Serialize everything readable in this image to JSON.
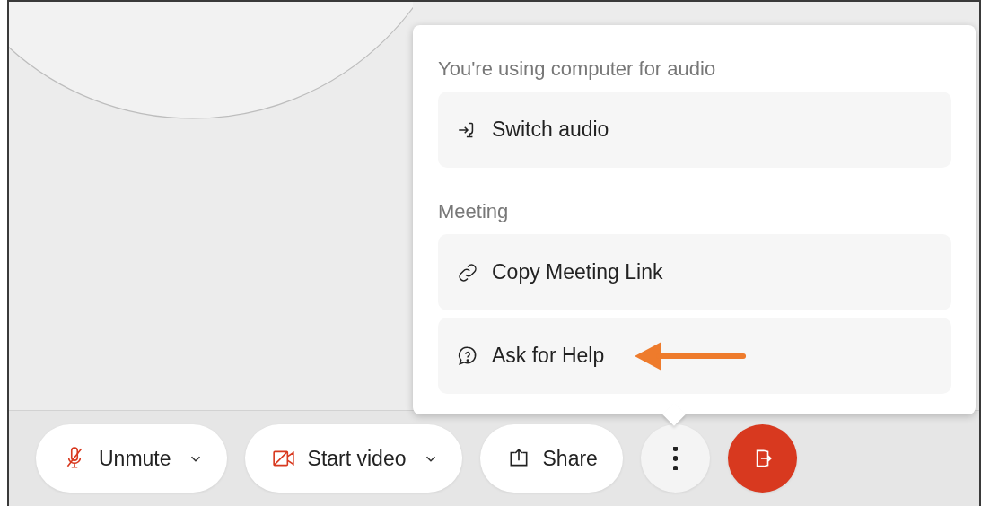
{
  "menu": {
    "sections": [
      {
        "heading": "You're using computer for audio",
        "items": [
          {
            "label": "Switch audio",
            "pointed_at": false
          }
        ]
      },
      {
        "heading": "Meeting",
        "items": [
          {
            "label": "Copy Meeting Link",
            "pointed_at": false
          },
          {
            "label": "Ask for Help",
            "pointed_at": true
          }
        ]
      }
    ]
  },
  "toolbar": [
    {
      "kind": "pill",
      "label": "Unmute",
      "dropdown": true
    },
    {
      "kind": "pill",
      "label": "Start video",
      "dropdown": true
    },
    {
      "kind": "pill",
      "label": "Share",
      "dropdown": false
    },
    {
      "kind": "round",
      "expanded": true
    },
    {
      "kind": "danger"
    }
  ]
}
